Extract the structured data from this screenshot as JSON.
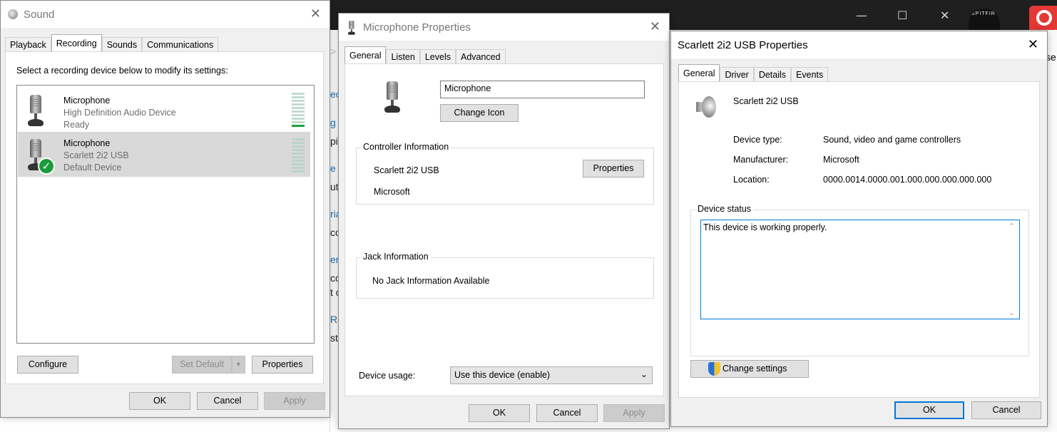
{
  "colors": {
    "accent": "#0078d7",
    "selected_row": "#d9d9d9",
    "meter_green": "#1ca342",
    "check_green": "#1a9d3c"
  },
  "background": {
    "window_controls": [
      "—",
      "☐",
      "✕"
    ],
    "left_fragments": [
      ">",
      "ec",
      "g",
      "pic",
      "e",
      "uto",
      "ria",
      "co",
      "en",
      "cc",
      "t c",
      "Re",
      "st"
    ],
    "right_fragment": "se"
  },
  "sound": {
    "title": "Sound",
    "tabs": [
      "Playback",
      "Recording",
      "Sounds",
      "Communications"
    ],
    "instruction": "Select a recording device below to modify its settings:",
    "devices": [
      {
        "name": "Microphone",
        "desc": "High Definition Audio Device",
        "status": "Ready"
      },
      {
        "name": "Microphone",
        "desc": "Scarlett 2i2 USB",
        "status": "Default Device"
      }
    ],
    "buttons": {
      "configure": "Configure",
      "set_default": "Set Default",
      "properties": "Properties",
      "ok": "OK",
      "cancel": "Cancel",
      "apply": "Apply"
    }
  },
  "mic_props": {
    "title": "Microphone Properties",
    "tabs": [
      "General",
      "Listen",
      "Levels",
      "Advanced"
    ],
    "name_value": "Microphone",
    "change_icon": "Change Icon",
    "controller_group": "Controller Information",
    "controller_name": "Scarlett 2i2 USB",
    "controller_vendor": "Microsoft",
    "properties_button": "Properties",
    "jack_group": "Jack Information",
    "jack_text": "No Jack Information Available",
    "usage_label": "Device usage:",
    "usage_value": "Use this device (enable)",
    "buttons": {
      "ok": "OK",
      "cancel": "Cancel",
      "apply": "Apply"
    }
  },
  "scarlett": {
    "title": "Scarlett 2i2 USB Properties",
    "tabs": [
      "General",
      "Driver",
      "Details",
      "Events"
    ],
    "device_name": "Scarlett 2i2 USB",
    "fields": [
      {
        "label": "Device type:",
        "value": "Sound, video and game controllers"
      },
      {
        "label": "Manufacturer:",
        "value": "Microsoft"
      },
      {
        "label": "Location:",
        "value": "0000.0014.0000.001.000.000.000.000.000"
      }
    ],
    "status_group": "Device status",
    "status_text": "This device is working properly.",
    "change_settings": "Change settings",
    "buttons": {
      "ok": "OK",
      "cancel": "Cancel"
    }
  }
}
